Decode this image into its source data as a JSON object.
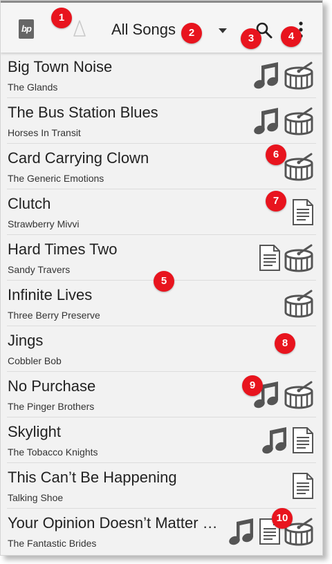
{
  "header": {
    "logo_text": "bp",
    "title": "All Songs"
  },
  "songs": [
    {
      "title": "Big Town Noise",
      "artist": "The Glands",
      "icons": [
        "music-note",
        "drum"
      ]
    },
    {
      "title": "The Bus Station Blues",
      "artist": "Horses In Transit",
      "icons": [
        "music-note",
        "drum"
      ]
    },
    {
      "title": "Card Carrying Clown",
      "artist": "The Generic Emotions",
      "icons": [
        "drum"
      ]
    },
    {
      "title": "Clutch",
      "artist": "Strawberry Mivvi",
      "icons": [
        "document"
      ]
    },
    {
      "title": "Hard Times Two",
      "artist": "Sandy Travers",
      "icons": [
        "document",
        "drum"
      ]
    },
    {
      "title": "Infinite Lives",
      "artist": "Three Berry Preserve",
      "icons": [
        "drum"
      ]
    },
    {
      "title": "Jings",
      "artist": "Cobbler Bob",
      "icons": []
    },
    {
      "title": "No Purchase",
      "artist": "The Pinger Brothers",
      "icons": [
        "music-note",
        "drum"
      ]
    },
    {
      "title": "Skylight",
      "artist": "The Tobacco Knights",
      "icons": [
        "music-note",
        "document"
      ]
    },
    {
      "title": "This Can’t Be Happening",
      "artist": "Talking Shoe",
      "icons": [
        "document"
      ]
    },
    {
      "title": "Your Opinion Doesn’t Matter …",
      "artist": "The Fantastic Brides",
      "icons": [
        "music-note",
        "document",
        "drum"
      ]
    }
  ],
  "callouts": [
    "1",
    "2",
    "3",
    "4",
    "5",
    "6",
    "7",
    "8",
    "9",
    "10"
  ],
  "colors": {
    "callout": "#e8141e",
    "icon": "#555555"
  }
}
